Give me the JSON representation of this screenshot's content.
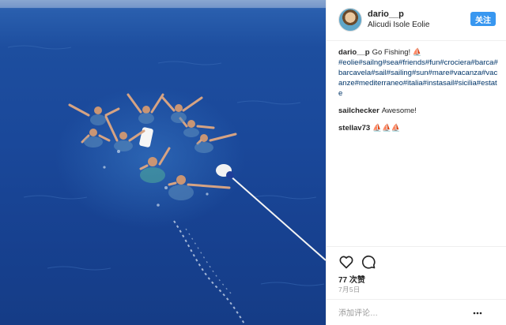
{
  "post": {
    "username": "dario__p",
    "location": "Alicudi Isole Eolie",
    "follow_label": "关注",
    "caption_user": "dario__p",
    "caption_lead": "Go Fishing! ⛵",
    "caption_tags": "#eolie#sailng#sea#friends#fun#crociera#barca#barcavela#sail#sailing#sun#mare#vacanza#vacanze#mediterraneo#italia#instasail#sicilia#estate"
  },
  "comments": [
    {
      "user": "sailchecker",
      "text": "Awesome!"
    },
    {
      "user": "stellav73",
      "text": "⛵⛵⛵"
    }
  ],
  "actions": {
    "like_icon": "heart-icon",
    "comment_icon": "comment-bubble-icon",
    "likes": "77 次赞",
    "date": "7月5日"
  },
  "add_comment": {
    "placeholder": "添加评论…",
    "more_icon": "ellipsis-icon"
  },
  "colors": {
    "follow_button": "#3897f0",
    "hashtag": "#003569",
    "sea": "#1a489a"
  }
}
